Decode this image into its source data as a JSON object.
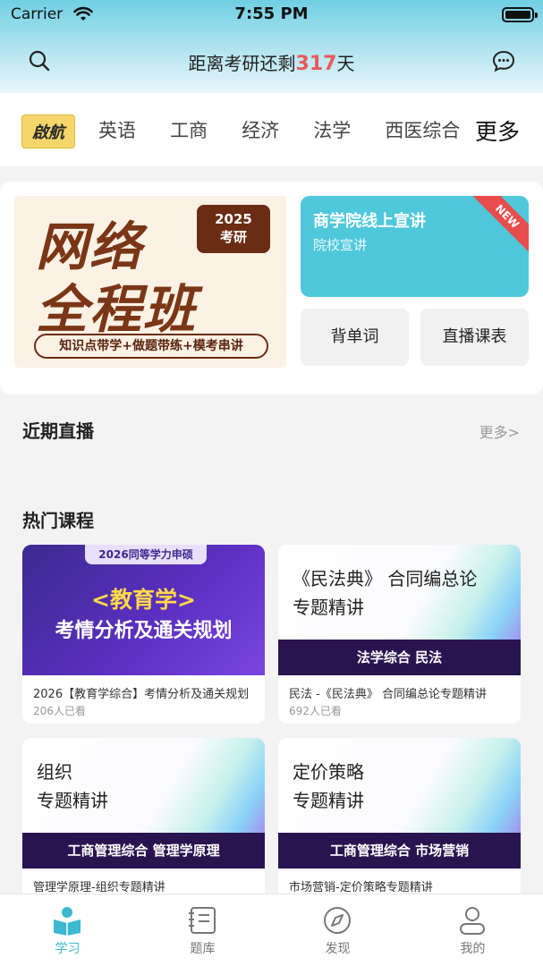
{
  "status_bar": {
    "carrier": "Carrier",
    "time": "7:55 PM"
  },
  "header": {
    "countdown_prefix": "距离考研还剩",
    "countdown_days": "317",
    "countdown_suffix": "天"
  },
  "categories": {
    "logo_text": "啟航",
    "items": [
      "英语",
      "工商",
      "经济",
      "法学",
      "西医综合"
    ],
    "more": "更多"
  },
  "banner": {
    "promo": {
      "line1": "网络",
      "line2": "全程班",
      "year": "2025",
      "year_label": "考研",
      "subtitle": "知识点带学+做题带练+模考串讲"
    },
    "lecture": {
      "title": "商学院线上宣讲",
      "subtitle": "院校宣讲",
      "badge": "NEW"
    },
    "buttons": {
      "words": "背单词",
      "live_schedule": "直播课表"
    }
  },
  "sections": {
    "recent_live": "近期直播",
    "recent_live_more": "更多>",
    "hot_courses": "热门课程"
  },
  "courses": [
    {
      "cover_tag": "2026同等学力申硕",
      "cover_big": "<教育学>",
      "cover_mid": "考情分析及通关规划",
      "title": "2026【教育学综合】考情分析及通关规划",
      "views": "206人已看"
    },
    {
      "cover_l1": "《民法典》 合同编总论",
      "cover_l2": "专题精讲",
      "cover_bar": "法学综合  民法",
      "title": "民法 -《民法典》 合同编总论专题精讲",
      "views": "692人已看"
    },
    {
      "cover_l1": "组织",
      "cover_l2": "专题精讲",
      "cover_bar": "工商管理综合  管理学原理",
      "title": "管理学原理-组织专题精讲"
    },
    {
      "cover_l1": "定价策略",
      "cover_l2": "专题精讲",
      "cover_bar": "工商管理综合  市场营销",
      "title": "市场营销-定价策略专题精讲"
    }
  ],
  "tabbar": {
    "items": [
      {
        "label": "学习",
        "icon": "study-icon",
        "active": true
      },
      {
        "label": "题库",
        "icon": "question-bank-icon",
        "active": false
      },
      {
        "label": "发现",
        "icon": "compass-icon",
        "active": false
      },
      {
        "label": "我的",
        "icon": "profile-icon",
        "active": false
      }
    ]
  },
  "colors": {
    "accent": "#3cb8d1",
    "countdown_red": "#ea5a5a",
    "lecture_bg": "#4fc8dc",
    "promo_brown": "#7a3616",
    "new_badge": "#e84d4d"
  }
}
